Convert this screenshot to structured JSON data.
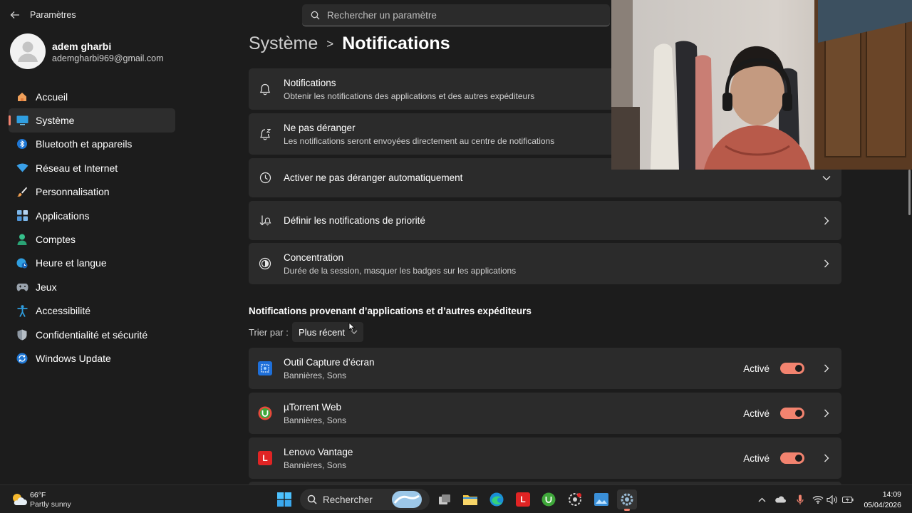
{
  "window": {
    "app_title": "Paramètres",
    "search_placeholder": "Rechercher un paramètre"
  },
  "profile": {
    "name": "adem gharbi",
    "email": "ademgharbi969@gmail.com"
  },
  "sidebar": {
    "items": [
      {
        "label": "Accueil",
        "icon": "home-icon"
      },
      {
        "label": "Système",
        "icon": "monitor-icon",
        "active": true
      },
      {
        "label": "Bluetooth et appareils",
        "icon": "bluetooth-icon"
      },
      {
        "label": "Réseau et Internet",
        "icon": "wifi-icon"
      },
      {
        "label": "Personnalisation",
        "icon": "brush-icon"
      },
      {
        "label": "Applications",
        "icon": "apps-icon"
      },
      {
        "label": "Comptes",
        "icon": "person-icon"
      },
      {
        "label": "Heure et langue",
        "icon": "globe-clock-icon"
      },
      {
        "label": "Jeux",
        "icon": "gamepad-icon"
      },
      {
        "label": "Accessibilité",
        "icon": "accessibility-icon"
      },
      {
        "label": "Confidentialité et sécurité",
        "icon": "shield-icon"
      },
      {
        "label": "Windows Update",
        "icon": "update-icon"
      }
    ]
  },
  "breadcrumb": {
    "parent": "Système",
    "separator": ">",
    "current": "Notifications"
  },
  "settings": [
    {
      "title": "Notifications",
      "subtitle": "Obtenir les notifications des applications et des autres expéditeurs",
      "icon": "bell-icon"
    },
    {
      "title": "Ne pas déranger",
      "subtitle": "Les notifications seront envoyées directement au centre de notifications",
      "icon": "bell-snooze-icon"
    },
    {
      "title": "Activer ne pas déranger automatiquement",
      "subtitle": "",
      "icon": "clock-icon",
      "control": "chevron-down"
    },
    {
      "title": "Définir les notifications de priorité",
      "subtitle": "",
      "icon": "priority-icon",
      "control": "chevron-right"
    },
    {
      "title": "Concentration",
      "subtitle": "Durée de la session, masquer les badges sur les applications",
      "icon": "focus-icon",
      "control": "chevron-right"
    }
  ],
  "app_section": {
    "title": "Notifications provenant d’applications et d’autres expéditeurs",
    "sort_label": "Trier par :",
    "sort_value": "Plus récent",
    "apps": [
      {
        "name": "Outil Capture d’écran",
        "detail": "Bannières, Sons",
        "state": "Activé",
        "enabled": true,
        "icon_color": "#1e6fd9",
        "icon_glyph": ""
      },
      {
        "name": "µTorrent Web",
        "detail": "Bannières, Sons",
        "state": "Activé",
        "enabled": true,
        "icon_color": "#2e9c3a",
        "icon_glyph": ""
      },
      {
        "name": "Lenovo Vantage",
        "detail": "Bannières, Sons",
        "state": "Activé",
        "enabled": true,
        "icon_color": "#e02424",
        "icon_glyph": "L"
      }
    ]
  },
  "taskbar": {
    "weather_temp": "66°F",
    "weather_desc": "Partly sunny",
    "search_label": "Rechercher",
    "time": "14:09",
    "date": "05/04/2026"
  },
  "colors": {
    "accent": "#f2836f",
    "background": "#1c1c1c",
    "card": "#2b2b2b"
  }
}
